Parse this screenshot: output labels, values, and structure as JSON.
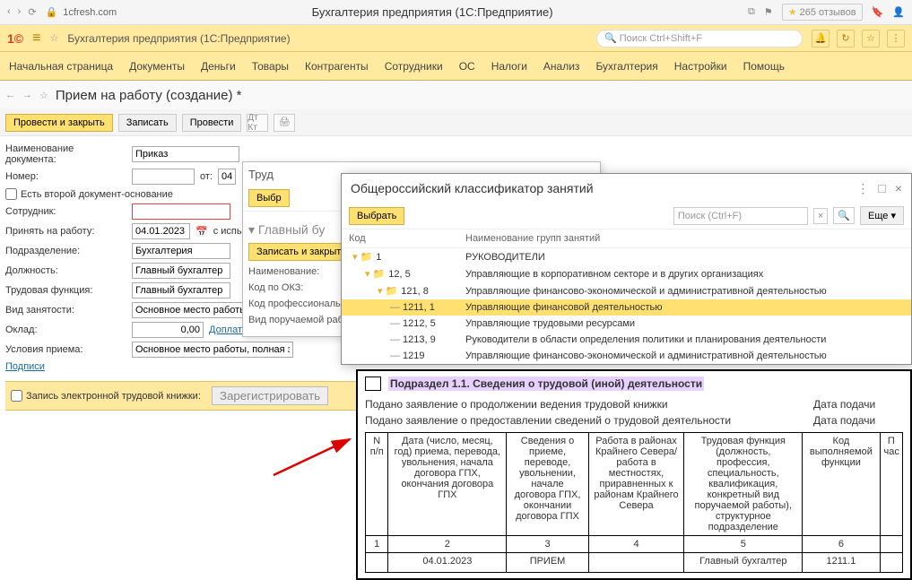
{
  "browser": {
    "url": "1cfresh.com",
    "title": "Бухгалтерия предприятия (1С:Предприятие)",
    "reviews": "265 отзывов"
  },
  "appHeader": {
    "name": "Бухгалтерия предприятия  (1С:Предприятие)",
    "searchPh": "Поиск Ctrl+Shift+F"
  },
  "tabs": [
    "Начальная страница",
    "Документы",
    "Деньги",
    "Товары",
    "Контрагенты",
    "Сотрудники",
    "ОС",
    "Налоги",
    "Анализ",
    "Бухгалтерия",
    "Настройки",
    "Помощь"
  ],
  "form": {
    "title": "Прием на работу (создание) *",
    "btnSave": "Провести и закрыть",
    "btnWrite": "Записать",
    "btnPost": "Провести",
    "docNameLabel": "Наименование документа:",
    "docName": "Приказ",
    "numLabel": "Номер:",
    "otLabel": "от:",
    "ot": "04",
    "secondDoc": "Есть второй документ-основание",
    "empLabel": "Сотрудник:",
    "dateLabel": "Принять на работу:",
    "date": "04.01.2023",
    "trial": "с испытан",
    "deptLabel": "Подразделение:",
    "dept": "Бухгалтерия",
    "posLabel": "Должность:",
    "pos": "Главный бухгалтер",
    "funcLabel": "Трудовая функция:",
    "func": "Главный бухгалтер",
    "emplTypeLabel": "Вид занятости:",
    "emplType": "Основное место работы",
    "salaryLabel": "Оклад:",
    "salary": "0,00",
    "extra": "Доплаты",
    "condLabel": "Условия приема:",
    "cond": "Основное место работы, полная занятос",
    "sign": "Подписи",
    "recordLabel": "Запись электронной трудовой книжки:",
    "regBtn": "Зарегистрировать"
  },
  "panel2": {
    "title": "Труд",
    "mainLabel": "Главный бу",
    "saveBtn": "Записать и закрыт",
    "selBtn": "Выбр",
    "nameLabel": "Наименование:",
    "okzLabel": "Код по ОКЗ:",
    "profLabel": "Код профессиональн деятельности:",
    "workLabel": "Вид поручаемой работы:"
  },
  "okz": {
    "title": "Общероссийский классификатор занятий",
    "selectBtn": "Выбрать",
    "searchPh": "Поиск (Ctrl+F)",
    "moreBtn": "Еще",
    "hCode": "Код",
    "hName": "Наименование групп занятий",
    "rows": [
      {
        "indent": 0,
        "type": "folder",
        "code": "1",
        "name": "РУКОВОДИТЕЛИ"
      },
      {
        "indent": 1,
        "type": "folder",
        "code": "12, 5",
        "name": "Управляющие в корпоративном секторе и в других организациях"
      },
      {
        "indent": 2,
        "type": "folder",
        "code": "121, 8",
        "name": "Управляющие финансово-экономической и административной деятельностью"
      },
      {
        "indent": 3,
        "type": "item",
        "code": "1211, 1",
        "name": "Управляющие финансовой деятельностью",
        "sel": true
      },
      {
        "indent": 3,
        "type": "item",
        "code": "1212, 5",
        "name": "Управляющие трудовыми ресурсами"
      },
      {
        "indent": 3,
        "type": "item",
        "code": "1213, 9",
        "name": "Руководители в области определения политики и планирования деятельности"
      },
      {
        "indent": 3,
        "type": "item",
        "code": "1219",
        "name": "Управляющие финансово-экономической и административной деятельностью"
      }
    ]
  },
  "doc": {
    "section": "Подраздел 1.1. Сведения о трудовой (иной) деятельности",
    "line1": "Подано заявление о продолжении ведения трудовой книжки",
    "dateLabel": "Дата подачи",
    "line2": "Подано заявление о предоставлении сведений о трудовой деятельности",
    "th": [
      "N п/п",
      "Дата (число, месяц, год) приема, перевода, увольнения, начала договора ГПХ, окончания договора ГПХ",
      "Сведения о приеме, переводе, увольнении, начале договора ГПХ, окончании договора ГПХ",
      "Работа в районах Крайнего Севера/ работа в местностях, приравненных к районам Крайнего Севера",
      "Трудовая функция (должность, профессия, специальность, квалификация, конкретный вид поручаемой работы), структурное подразделение",
      "Код выполняемой функции",
      "П час"
    ],
    "numRow": [
      "1",
      "2",
      "3",
      "4",
      "5",
      "6",
      ""
    ],
    "dataRow": [
      "",
      "04.01.2023",
      "ПРИЕМ",
      "",
      "Главный бухгалтер",
      "1211.1",
      ""
    ]
  }
}
